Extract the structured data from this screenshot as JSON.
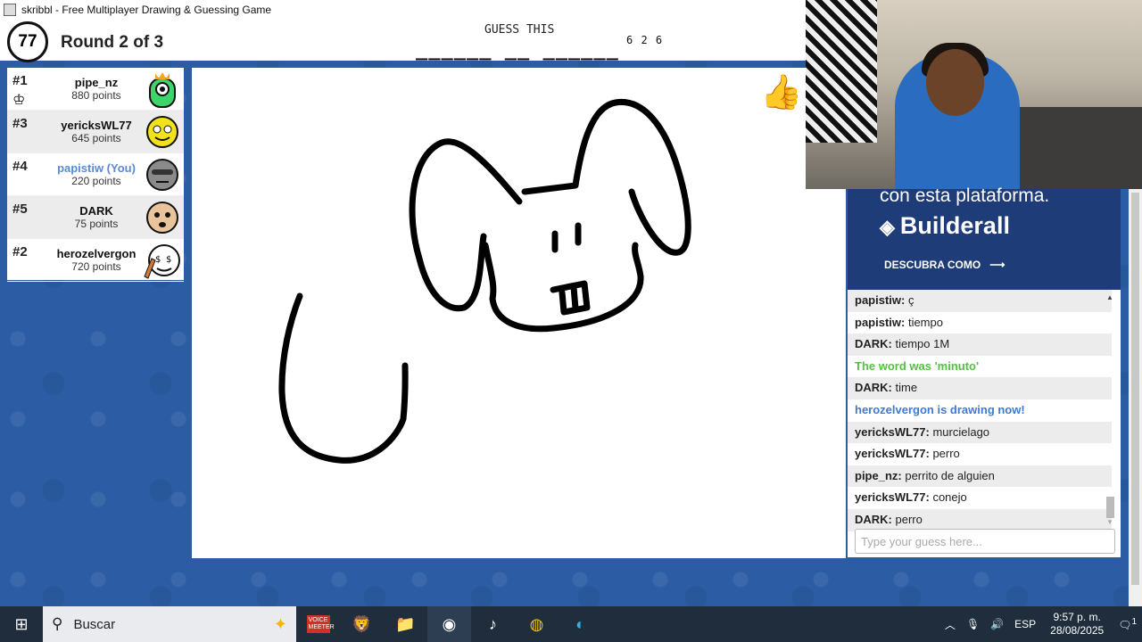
{
  "window": {
    "title": "skribbl - Free Multiplayer Drawing & Guessing Game"
  },
  "game": {
    "timer": "77",
    "round": "Round 2 of 3",
    "guess_label": "GUESS THIS",
    "word_blanks": "______ __ ______",
    "word_counts": "6 2 6"
  },
  "players": [
    {
      "rank": "#1",
      "name": "pipe_nz",
      "points": "880 points",
      "avatar_color": "#3dd46a"
    },
    {
      "rank": "#3",
      "name": "yericksWL77",
      "points": "645 points",
      "avatar_color": "#f2e21b"
    },
    {
      "rank": "#4",
      "name": "papistiw (You)",
      "points": "220 points",
      "avatar_color": "#8a8a8a"
    },
    {
      "rank": "#5",
      "name": "DARK",
      "points": "75 points",
      "avatar_color": "#e9c39a"
    },
    {
      "rank": "#2",
      "name": "herozelvergon",
      "points": "720 points",
      "avatar_color": "#ffffff"
    }
  ],
  "ad": {
    "line1": "con esta plataforma.",
    "brand": "Builderall",
    "cta": "DESCUBRA COMO"
  },
  "chat": {
    "messages": [
      {
        "who": "papistiw:",
        "text": " ç"
      },
      {
        "who": "papistiw:",
        "text": " tiempo"
      },
      {
        "who": "DARK:",
        "text": " tiempo 1M"
      },
      {
        "who": "",
        "text": "The word was 'minuto'"
      },
      {
        "who": "DARK:",
        "text": " time"
      },
      {
        "who": "",
        "text": "herozelvergon is drawing now!"
      },
      {
        "who": "yericksWL77:",
        "text": " murcielago"
      },
      {
        "who": "yericksWL77:",
        "text": " perro"
      },
      {
        "who": "pipe_nz:",
        "text": " perrito de alguien"
      },
      {
        "who": "yericksWL77:",
        "text": " conejo"
      },
      {
        "who": "DARK:",
        "text": " perro"
      }
    ],
    "input_placeholder": "Type your guess here..."
  },
  "taskbar": {
    "search_label": "Buscar",
    "language": "ESP",
    "time": "9:57 p. m.",
    "date": "28/08/2025",
    "notification_count": "1",
    "voicemeeter_label": "VOICE MEETER"
  }
}
